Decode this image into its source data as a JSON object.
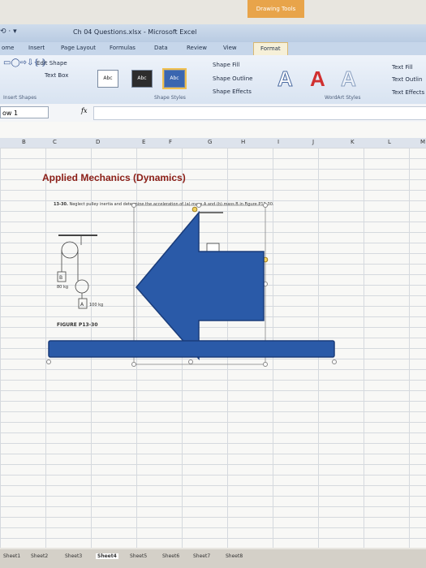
{
  "window": {
    "title": "Ch 04 Questions.xlsx - Microsoft Excel",
    "context_tab_group": "Drawing Tools"
  },
  "quick_access": {
    "symbols": "⟲ · ▾"
  },
  "tabs": [
    {
      "label": "ome"
    },
    {
      "label": "Insert"
    },
    {
      "label": "Page Layout"
    },
    {
      "label": "Formulas"
    },
    {
      "label": "Data"
    },
    {
      "label": "Review"
    },
    {
      "label": "View"
    },
    {
      "label": "Format"
    }
  ],
  "ribbon": {
    "insert_shapes": {
      "edit_shape": "Edit Shape",
      "text_box": "Text Box",
      "group_label": "Insert Shapes"
    },
    "shape_styles": {
      "styles": [
        "Abc",
        "Abc",
        "Abc"
      ],
      "group_label": "Shape Styles",
      "fill": "Shape Fill",
      "outline": "Shape Outline",
      "effects": "Shape Effects"
    },
    "wordart": {
      "letters": [
        "A",
        "A",
        "A"
      ],
      "fill": "Text Fill",
      "outline": "Text Outlin",
      "effects": "Text Effects",
      "group_label": "WordArt Styles"
    }
  },
  "formula_bar": {
    "name_box": "ow 1",
    "fx": "fx"
  },
  "columns": [
    "B",
    "C",
    "D",
    "E",
    "F",
    "G",
    "H",
    "I",
    "J",
    "K",
    "L",
    "M"
  ],
  "content": {
    "heading": "Applied Mechanics (Dynamics)",
    "problem_number": "13-30.",
    "problem_text": "Neglect pulley inertia and determine the acceleration of (a) mass A and (b) mass B in Figure P13-30.",
    "mass_b_label": "B",
    "mass_b_value": "80 kg",
    "mass_a_label": "A",
    "mass_a_value": "100 kg",
    "figure_label": "FIGURE P13-30"
  },
  "shapes": {
    "arrow_color": "#2a5aa8",
    "bar_color": "#2a5aa8",
    "arrow_direction": "left"
  },
  "sheet_tabs": [
    {
      "label": "Sheet1"
    },
    {
      "label": "Sheet2"
    },
    {
      "label": "Sheet3"
    },
    {
      "label": "Sheet4",
      "active": true
    },
    {
      "label": "Sheet5"
    },
    {
      "label": "Sheet6"
    },
    {
      "label": "Sheet7"
    },
    {
      "label": "Sheet8"
    }
  ]
}
